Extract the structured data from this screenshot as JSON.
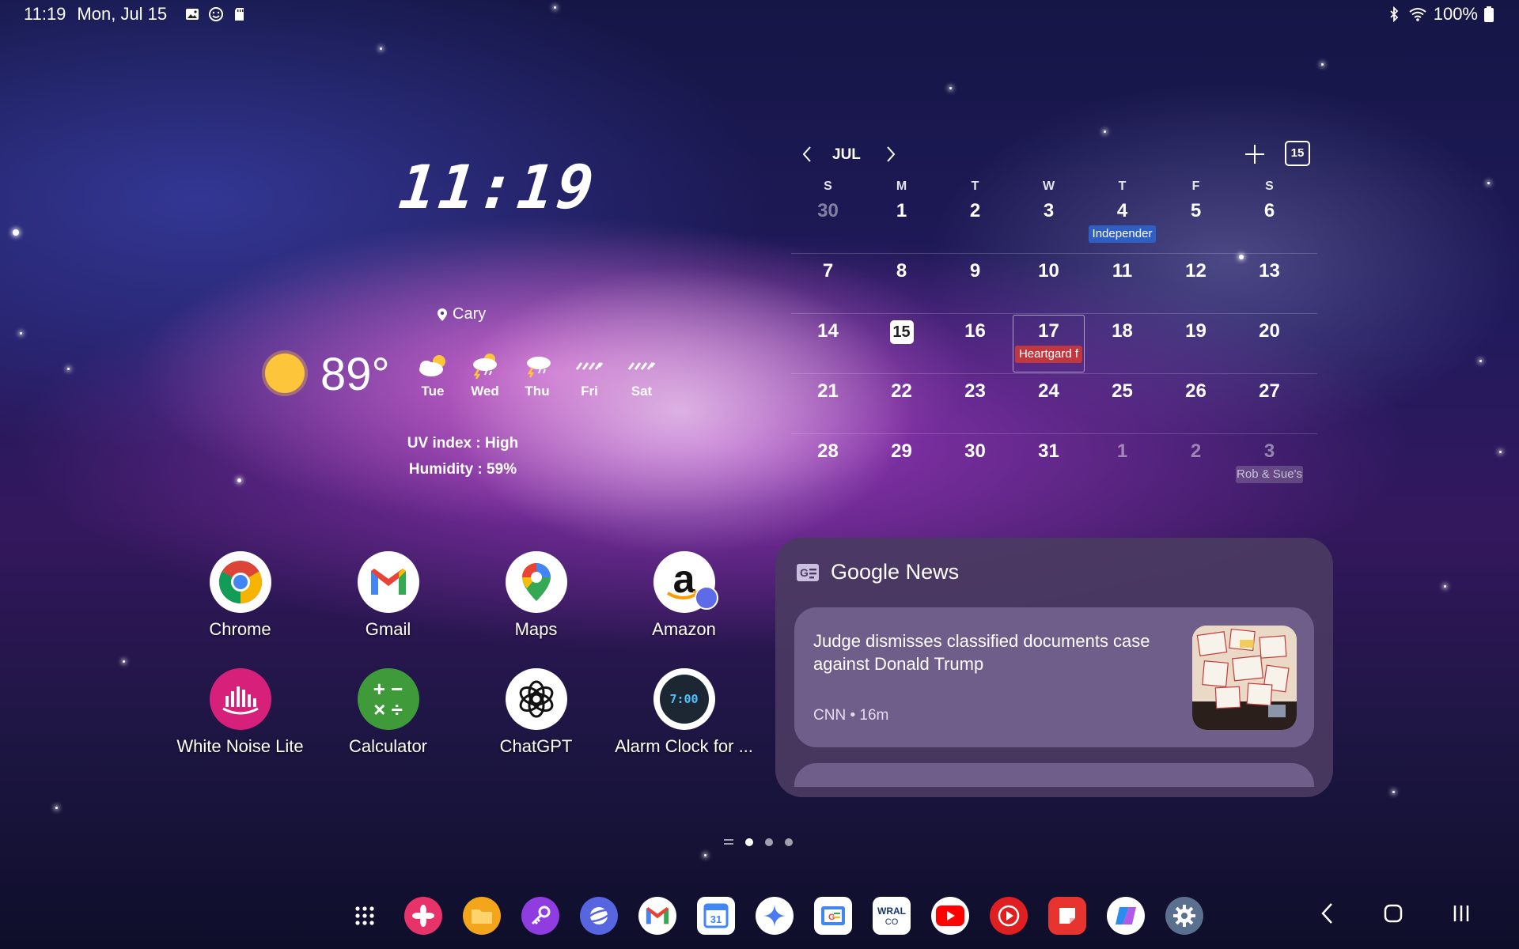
{
  "status_bar": {
    "time": "11:19",
    "date": "Mon, Jul 15",
    "battery": "100%",
    "left_icons": [
      "image-notification-icon",
      "emoji-notification-icon",
      "sd-card-icon"
    ],
    "right_icons": [
      "bluetooth-icon",
      "wifi-icon",
      "battery-icon"
    ]
  },
  "clock": {
    "time": "11:19"
  },
  "weather": {
    "location": "Cary",
    "temperature": "89°",
    "current_icon": "sunny-icon",
    "forecast": [
      {
        "day": "Tue",
        "icon": "partly-cloudy-icon"
      },
      {
        "day": "Wed",
        "icon": "thunderstorm-icon"
      },
      {
        "day": "Thu",
        "icon": "thunderstorm-icon"
      },
      {
        "day": "Fri",
        "icon": "rain-icon"
      },
      {
        "day": "Sat",
        "icon": "rain-icon"
      }
    ],
    "uv": "UV index : High",
    "humidity": "Humidity : 59%"
  },
  "calendar": {
    "month": "JUL",
    "today_badge": "15",
    "weekdays": [
      "S",
      "M",
      "T",
      "W",
      "T",
      "F",
      "S"
    ],
    "weeks": [
      [
        {
          "d": "30",
          "dim": true
        },
        {
          "d": "1"
        },
        {
          "d": "2"
        },
        {
          "d": "3"
        },
        {
          "d": "4",
          "event": "Independer",
          "ev_color": "blue"
        },
        {
          "d": "5"
        },
        {
          "d": "6"
        }
      ],
      [
        {
          "d": "7"
        },
        {
          "d": "8"
        },
        {
          "d": "9"
        },
        {
          "d": "10"
        },
        {
          "d": "11"
        },
        {
          "d": "12"
        },
        {
          "d": "13"
        }
      ],
      [
        {
          "d": "14"
        },
        {
          "d": "15",
          "today": true
        },
        {
          "d": "16"
        },
        {
          "d": "17",
          "selected": true,
          "event": "Heartgard f",
          "ev_color": "red"
        },
        {
          "d": "18"
        },
        {
          "d": "19"
        },
        {
          "d": "20"
        }
      ],
      [
        {
          "d": "21"
        },
        {
          "d": "22"
        },
        {
          "d": "23"
        },
        {
          "d": "24"
        },
        {
          "d": "25"
        },
        {
          "d": "26"
        },
        {
          "d": "27"
        }
      ],
      [
        {
          "d": "28"
        },
        {
          "d": "29"
        },
        {
          "d": "30"
        },
        {
          "d": "31"
        },
        {
          "d": "1",
          "dim": true
        },
        {
          "d": "2",
          "dim": true
        },
        {
          "d": "3",
          "dim": true,
          "event": "Rob & Sue's",
          "ev_color": "gray"
        }
      ]
    ]
  },
  "apps": [
    {
      "label": "Chrome",
      "icon": "chrome-icon"
    },
    {
      "label": "Gmail",
      "icon": "gmail-icon"
    },
    {
      "label": "Maps",
      "icon": "maps-icon"
    },
    {
      "label": "Amazon",
      "icon": "amazon-icon"
    },
    {
      "label": "White Noise Lite",
      "icon": "white-noise-icon"
    },
    {
      "label": "Calculator",
      "icon": "calculator-icon"
    },
    {
      "label": "ChatGPT",
      "icon": "chatgpt-icon"
    },
    {
      "label": "Alarm Clock for ...",
      "icon": "alarm-clock-icon"
    }
  ],
  "news": {
    "app_name": "Google News",
    "headline": "Judge dismisses classified documents case against Donald Trump",
    "source": "CNN • 16m"
  },
  "pager": {
    "pages": 3,
    "current": 1
  },
  "dock": [
    {
      "icon": "app-drawer-icon",
      "color": "transparent"
    },
    {
      "icon": "gallery-icon",
      "color": "#e8336a"
    },
    {
      "icon": "my-files-icon",
      "color": "#f3a51c"
    },
    {
      "icon": "samsung-pass-icon",
      "color": "#8f3ce0"
    },
    {
      "icon": "samsung-internet-icon",
      "color": "#5865e0"
    },
    {
      "icon": "gmail-icon",
      "color": "#ffffff"
    },
    {
      "icon": "google-calendar-icon",
      "color": "#ffffff"
    },
    {
      "icon": "gemini-icon",
      "color": "#ffffff"
    },
    {
      "icon": "google-news-icon",
      "color": "#ffffff"
    },
    {
      "icon": "wral-news-icon",
      "color": "#ffffff"
    },
    {
      "icon": "youtube-icon",
      "color": "#ffffff"
    },
    {
      "icon": "youtube-music-icon",
      "color": "#e02020"
    },
    {
      "icon": "notes-icon",
      "color": "#e8342f"
    },
    {
      "icon": "copilot-icon",
      "color": "#ffffff"
    },
    {
      "icon": "settings-icon",
      "color": "#5b6f8f"
    }
  ],
  "nav_bar": [
    "back-icon",
    "home-icon",
    "recents-icon"
  ]
}
